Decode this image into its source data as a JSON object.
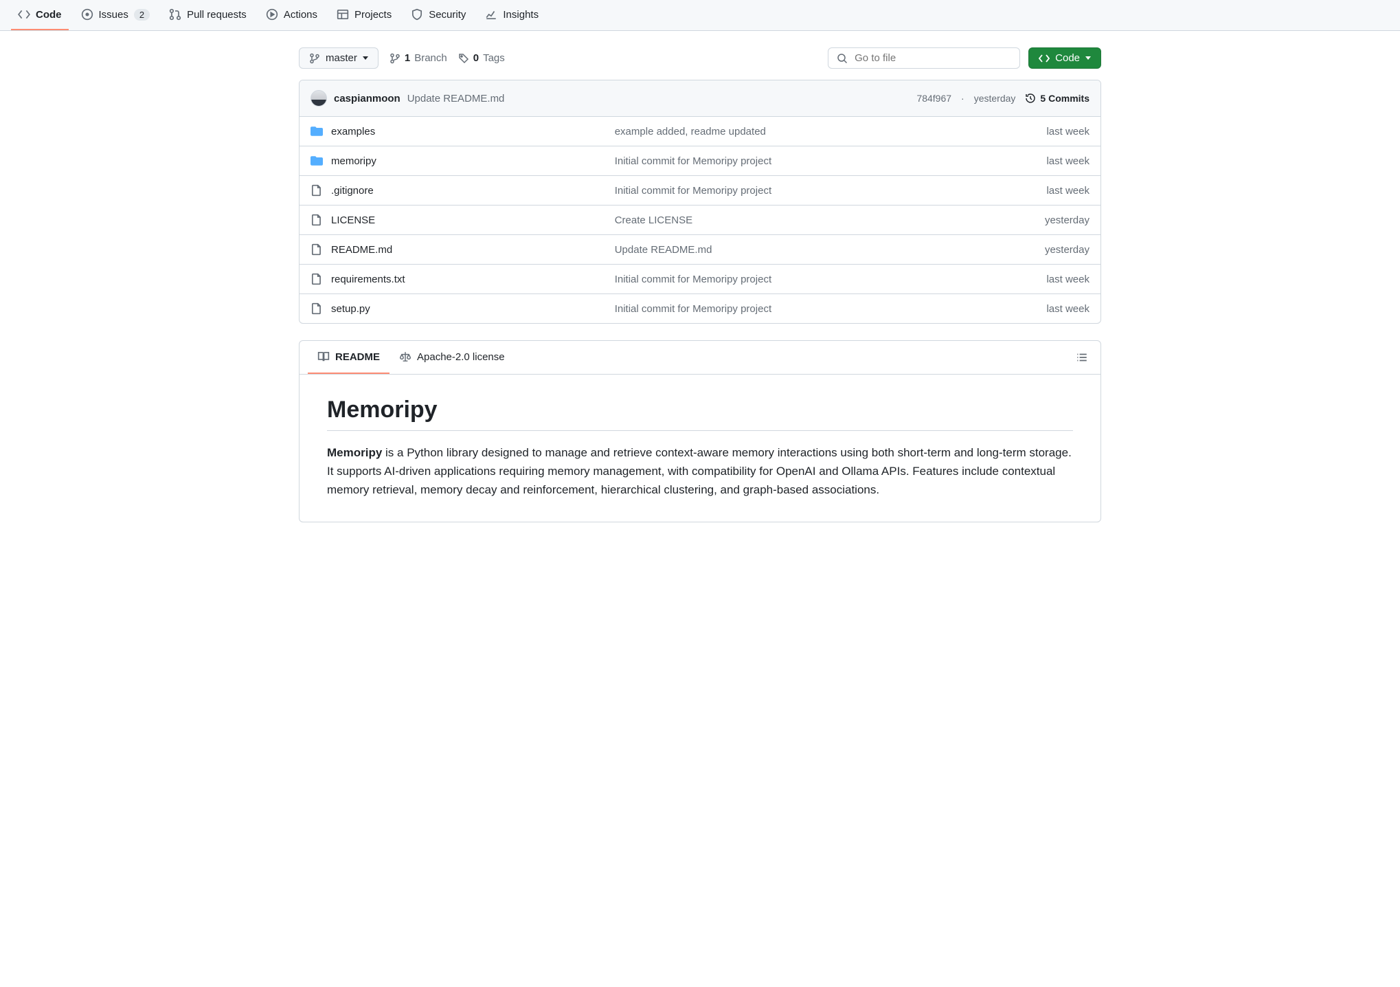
{
  "nav": {
    "code": "Code",
    "issues": "Issues",
    "issues_count": "2",
    "pulls": "Pull requests",
    "actions": "Actions",
    "projects": "Projects",
    "security": "Security",
    "insights": "Insights"
  },
  "branch": {
    "name": "master",
    "branch_count": "1",
    "branch_label": "Branch",
    "tag_count": "0",
    "tag_label": "Tags"
  },
  "search": {
    "placeholder": "Go to file"
  },
  "code_button": "Code",
  "latest_commit": {
    "author": "caspianmoon",
    "message": "Update README.md",
    "sha": "784f967",
    "age": "yesterday",
    "commits_count": "5 Commits"
  },
  "files": [
    {
      "type": "dir",
      "name": "examples",
      "msg": "example added, readme updated",
      "age": "last week"
    },
    {
      "type": "dir",
      "name": "memoripy",
      "msg": "Initial commit for Memoripy project",
      "age": "last week"
    },
    {
      "type": "file",
      "name": ".gitignore",
      "msg": "Initial commit for Memoripy project",
      "age": "last week"
    },
    {
      "type": "file",
      "name": "LICENSE",
      "msg": "Create LICENSE",
      "age": "yesterday"
    },
    {
      "type": "file",
      "name": "README.md",
      "msg": "Update README.md",
      "age": "yesterday"
    },
    {
      "type": "file",
      "name": "requirements.txt",
      "msg": "Initial commit for Memoripy project",
      "age": "last week"
    },
    {
      "type": "file",
      "name": "setup.py",
      "msg": "Initial commit for Memoripy project",
      "age": "last week"
    }
  ],
  "readme_tabs": {
    "readme": "README",
    "license": "Apache-2.0 license"
  },
  "readme": {
    "title": "Memoripy",
    "lead_bold": "Memoripy",
    "lead_rest": " is a Python library designed to manage and retrieve context-aware memory interactions using both short-term and long-term storage. It supports AI-driven applications requiring memory management, with compatibility for OpenAI and Ollama APIs. Features include contextual memory retrieval, memory decay and reinforcement, hierarchical clustering, and graph-based associations."
  }
}
